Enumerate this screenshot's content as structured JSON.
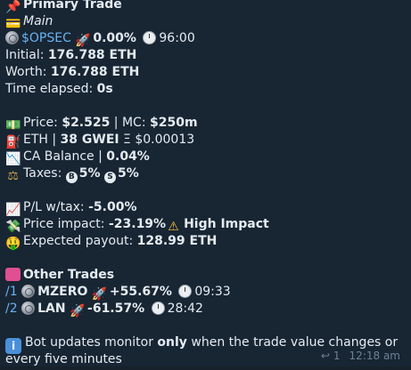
{
  "header": {
    "title": "Primary Trade",
    "subtitle": "Main"
  },
  "primary": {
    "ticker": "$OPSEC",
    "pct": "0.00%",
    "timer": "96:00",
    "initial_label": "Initial: ",
    "initial_value": "176.788 ETH",
    "worth_label": "Worth: ",
    "worth_value": "176.788 ETH",
    "elapsed_label": "Time elapsed: ",
    "elapsed_value": "0s"
  },
  "market": {
    "price_label": "Price: ",
    "price_value": "$2.525",
    "mc_sep": " | MC: ",
    "mc_value": "$250m",
    "gas_label": "ETH | ",
    "gas_value": "38 GWEI",
    "gas_extra": " Ξ $0.00013",
    "ca_label": "CA Balance | ",
    "ca_value": "0.04%",
    "taxes_label": "Taxes: ",
    "buy_tax": "5%",
    "sell_tax": "5%",
    "buy_icon": "B",
    "sell_icon": "S"
  },
  "pnl": {
    "pl_label": "P/L w/tax: ",
    "pl_value": "-5.00%",
    "impact_label": "Price impact: ",
    "impact_value": "-23.19%",
    "impact_warning": "High Impact",
    "payout_label": "Expected payout: ",
    "payout_value": "128.99 ETH"
  },
  "other": {
    "title": "Other Trades",
    "trades": [
      {
        "cmd": "/1",
        "ticker": "MZERO",
        "pct": "+55.67%",
        "timer": "09:33"
      },
      {
        "cmd": "/2",
        "ticker": "LAN",
        "pct": "-61.57%",
        "timer": "28:42"
      }
    ]
  },
  "footer": {
    "note_pre": "Bot updates monitor ",
    "note_bold": "only",
    "note_post": " when the trade value changes or",
    "note_line2": "every five minutes",
    "replies": "1",
    "time": "12:18 am"
  }
}
